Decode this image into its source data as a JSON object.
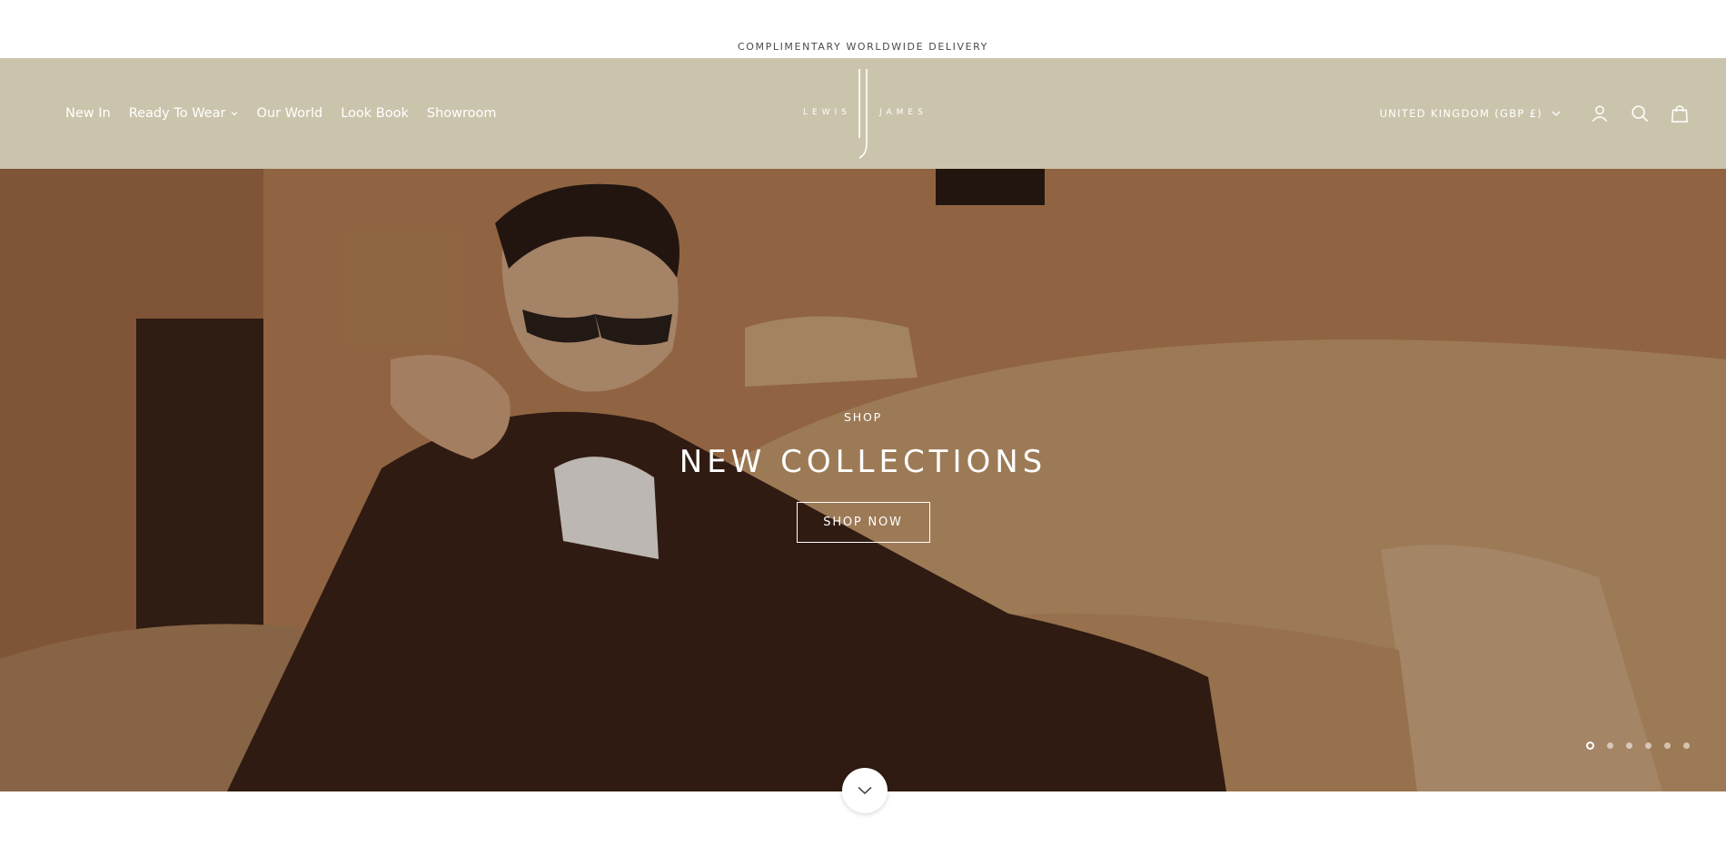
{
  "announcement": {
    "text": "COMPLIMENTARY WORLDWIDE DELIVERY"
  },
  "header": {
    "nav": [
      {
        "label": "New In",
        "has_dropdown": false
      },
      {
        "label": "Ready To Wear",
        "has_dropdown": true
      },
      {
        "label": "Our World",
        "has_dropdown": false
      },
      {
        "label": "Look Book",
        "has_dropdown": false
      },
      {
        "label": "Showroom",
        "has_dropdown": false
      }
    ],
    "logo": {
      "left": "LEWIS",
      "right": "JAMES"
    },
    "country_selector": "UNITED KINGDOM (GBP £)",
    "icons": [
      "account-icon",
      "search-icon",
      "bag-icon"
    ]
  },
  "hero": {
    "subtitle": "SHOP",
    "title": "NEW COLLECTIONS",
    "cta": "SHOP NOW",
    "slides_total": 6,
    "active_slide": 1
  },
  "colors": {
    "header_bg": "#cbc4ac",
    "hero_bg": "#b17c52",
    "text_on_dark": "#ffffff"
  }
}
